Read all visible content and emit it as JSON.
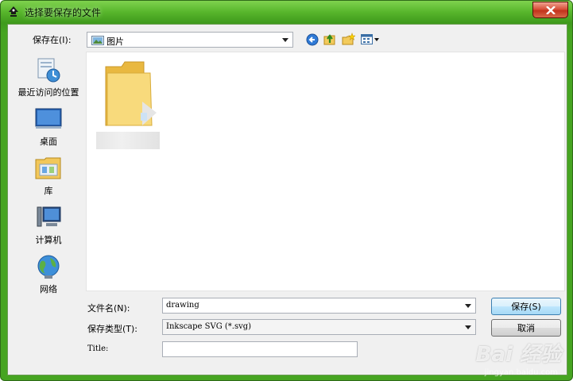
{
  "window": {
    "title": "选择要保存的文件",
    "close_icon": "close-icon",
    "app_icon": "inkscape-icon"
  },
  "save_in": {
    "label": "保存在(I):",
    "value": "图片",
    "folder_icon": "pictures-folder-icon"
  },
  "toolbar": {
    "icons": [
      "back-icon",
      "up-folder-icon",
      "new-folder-icon",
      "view-menu-icon"
    ]
  },
  "places": [
    {
      "label": "最近访问的位置",
      "icon": "recent-places-icon"
    },
    {
      "label": "桌面",
      "icon": "desktop-icon"
    },
    {
      "label": "库",
      "icon": "libraries-icon"
    },
    {
      "label": "计算机",
      "icon": "computer-icon"
    },
    {
      "label": "网络",
      "icon": "network-icon"
    }
  ],
  "files": [
    {
      "name": "",
      "icon": "folder-icon"
    }
  ],
  "filename": {
    "label": "文件名(N):",
    "value": "drawing"
  },
  "filetype": {
    "label": "保存类型(T):",
    "value": "Inkscape SVG (*.svg)"
  },
  "title_field": {
    "label": "Title:",
    "value": ""
  },
  "buttons": {
    "save": "保存(S)",
    "cancel": "取消"
  },
  "watermark": {
    "text": "Bai 经验",
    "sub": "jingyan.baidu.com"
  }
}
